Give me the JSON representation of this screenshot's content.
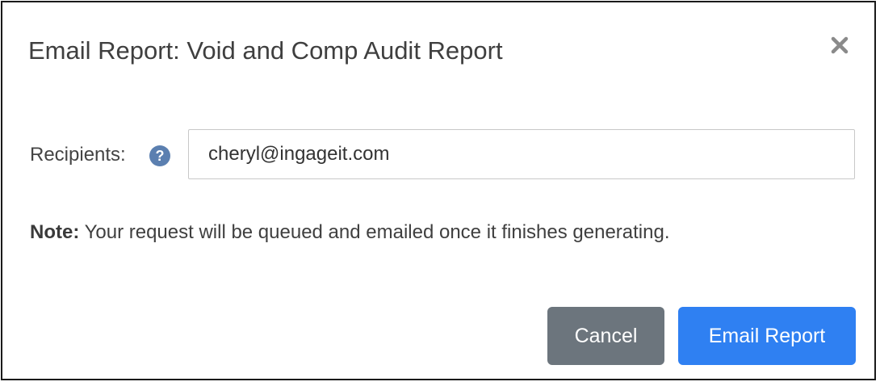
{
  "dialog": {
    "title": "Email Report: Void and Comp Audit Report",
    "close_icon": "close-icon"
  },
  "recipients": {
    "label": "Recipients:",
    "help_icon": "question-circle-icon",
    "value": "cheryl@ingageit.com",
    "placeholder": ""
  },
  "note": {
    "label": "Note:",
    "text": " Your request will be queued and emailed once it finishes generating."
  },
  "buttons": {
    "cancel_label": "Cancel",
    "email_label": "Email Report"
  },
  "colors": {
    "primary": "#2f80f2",
    "secondary": "#6c757d",
    "help_icon": "#5b7fb0"
  }
}
